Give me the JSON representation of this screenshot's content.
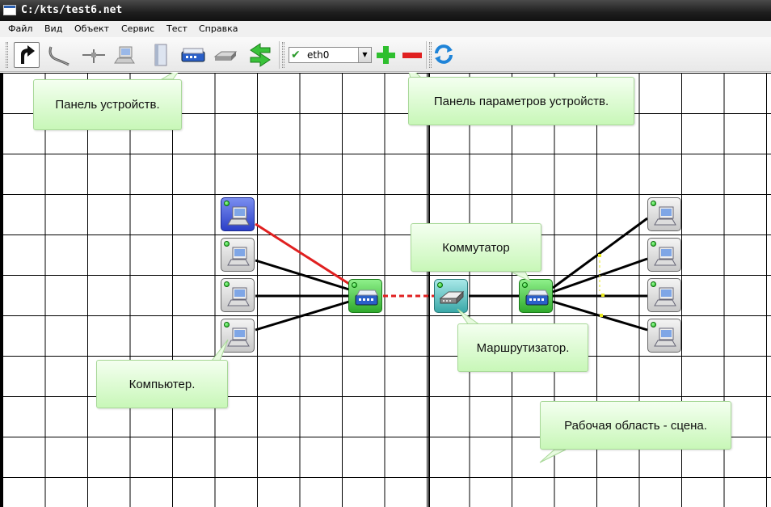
{
  "window": {
    "title": "C:/kts/test6.net"
  },
  "menu": [
    "Файл",
    "Вид",
    "Объект",
    "Сервис",
    "Тест",
    "Справка"
  ],
  "toolbar": {
    "tools": [
      {
        "name": "select-tool-icon",
        "active": true
      },
      {
        "name": "cable-tool-icon"
      },
      {
        "name": "bus-connector-icon"
      },
      {
        "name": "computer-tool-icon"
      },
      {
        "name": "server-tool-icon"
      },
      {
        "name": "switch-tool-icon"
      },
      {
        "name": "router-tool-icon"
      },
      {
        "name": "move-tool-icon"
      }
    ],
    "interface_select": {
      "value": "eth0"
    },
    "actions": [
      "add-interface-icon",
      "remove-interface-icon",
      "refresh-icon"
    ]
  },
  "callouts": {
    "device_panel": "Панель устройств.",
    "params_panel": "Панель параметров устройств.",
    "switch": "Коммутатор",
    "router": "Маршрутизатор.",
    "computer": "Компьютер.",
    "scene": "Рабочая область - сцена."
  },
  "colors": {
    "active_link": "#e02020",
    "link": "#000000",
    "callout_bg": "#d9f9cc",
    "switch_fill": "#3fc83a",
    "router_fill": "#5ac0c0",
    "selected_pc": "#3a4fd8"
  }
}
